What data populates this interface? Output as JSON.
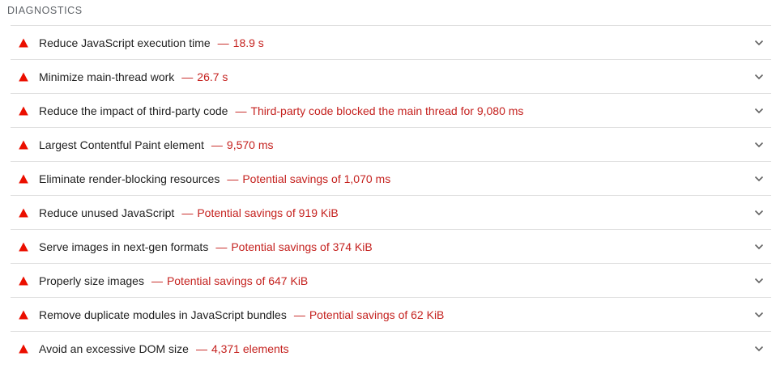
{
  "section": {
    "title": "DIAGNOSTICS"
  },
  "colors": {
    "fail": "#eb0f00",
    "value_text": "#c5221f",
    "divider": "#e0e0e0"
  },
  "icons": {
    "status": "warning-triangle-icon",
    "expand": "chevron-down-icon"
  },
  "audits": [
    {
      "title": "Reduce JavaScript execution time",
      "separator": "—",
      "value": "18.9 s"
    },
    {
      "title": "Minimize main-thread work",
      "separator": "—",
      "value": "26.7 s"
    },
    {
      "title": "Reduce the impact of third-party code",
      "separator": "—",
      "value": "Third-party code blocked the main thread for 9,080 ms"
    },
    {
      "title": "Largest Contentful Paint element",
      "separator": "—",
      "value": "9,570 ms"
    },
    {
      "title": "Eliminate render-blocking resources",
      "separator": "—",
      "value": "Potential savings of 1,070 ms"
    },
    {
      "title": "Reduce unused JavaScript",
      "separator": "—",
      "value": "Potential savings of 919 KiB"
    },
    {
      "title": "Serve images in next-gen formats",
      "separator": "—",
      "value": "Potential savings of 374 KiB"
    },
    {
      "title": "Properly size images",
      "separator": "—",
      "value": "Potential savings of 647 KiB"
    },
    {
      "title": "Remove duplicate modules in JavaScript bundles",
      "separator": "—",
      "value": "Potential savings of 62 KiB"
    },
    {
      "title": "Avoid an excessive DOM size",
      "separator": "—",
      "value": "4,371 elements"
    }
  ]
}
